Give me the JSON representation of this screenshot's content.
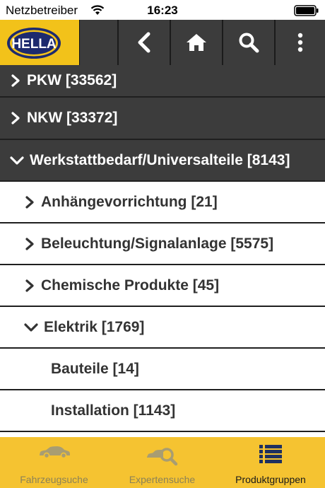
{
  "status_bar": {
    "carrier": "Netzbetreiber",
    "time": "16:23"
  },
  "header": {
    "logo_text": "HELLA",
    "icons": [
      "chevron-left-icon",
      "home-icon",
      "search-icon",
      "more-vertical-icon"
    ]
  },
  "categories": [
    {
      "label": "PKW [33562]",
      "state": "collapsed",
      "level": 0
    },
    {
      "label": "NKW [33372]",
      "state": "collapsed",
      "level": 0
    },
    {
      "label": "Werkstattbedarf/Universalteile [8143]",
      "state": "expanded",
      "level": 0
    },
    {
      "label": "Anhängevorrichtung [21]",
      "state": "collapsed",
      "level": 1
    },
    {
      "label": "Beleuchtung/Signalanlage [5575]",
      "state": "collapsed",
      "level": 1
    },
    {
      "label": "Chemische Produkte [45]",
      "state": "collapsed",
      "level": 1
    },
    {
      "label": "Elektrik [1769]",
      "state": "expanded",
      "level": 1
    },
    {
      "label": "Bauteile [14]",
      "state": "leaf",
      "level": 2
    },
    {
      "label": "Installation [1143]",
      "state": "leaf",
      "level": 2
    }
  ],
  "tabbar": {
    "tabs": [
      {
        "label": "Fahrzeugsuche",
        "icon": "car-icon",
        "active": false
      },
      {
        "label": "Expertensuche",
        "icon": "expert-search-icon",
        "active": false
      },
      {
        "label": "Produktgruppen",
        "icon": "list-icon",
        "active": true
      }
    ]
  },
  "colors": {
    "brand_yellow": "#f2c21a",
    "dark_row": "#3c3c3c",
    "tabbar": "#f5c331"
  }
}
